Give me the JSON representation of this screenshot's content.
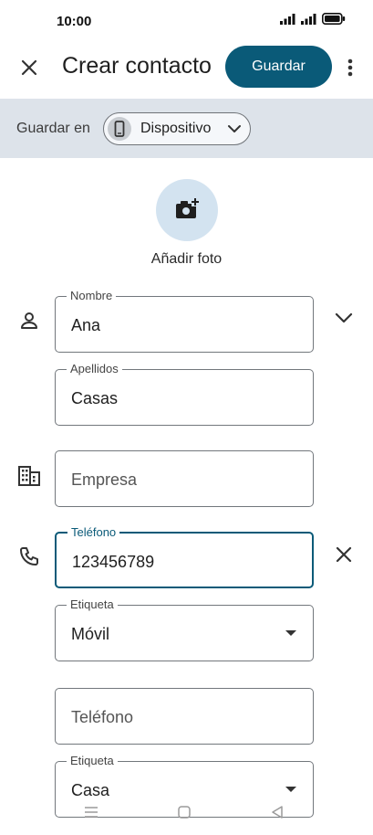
{
  "status": {
    "time": "10:00"
  },
  "header": {
    "title": "Crear contacto",
    "save_label": "Guardar"
  },
  "save_in": {
    "label": "Guardar en",
    "device": "Dispositivo"
  },
  "photo": {
    "label": "Añadir foto"
  },
  "fields": {
    "first_name": {
      "label": "Nombre",
      "value": "Ana"
    },
    "last_name": {
      "label": "Apellidos",
      "value": "Casas"
    },
    "company": {
      "placeholder": "Empresa"
    },
    "phone": {
      "label": "Teléfono",
      "value": "123456789"
    },
    "phone_label": {
      "label": "Etiqueta",
      "value": "Móvil"
    },
    "phone2": {
      "placeholder": "Teléfono"
    },
    "phone2_label": {
      "label": "Etiqueta",
      "value": "Casa"
    }
  },
  "colors": {
    "accent": "#0a5a78",
    "bar_bg": "#dde3ea",
    "photo_bg": "#d3e3f0"
  }
}
